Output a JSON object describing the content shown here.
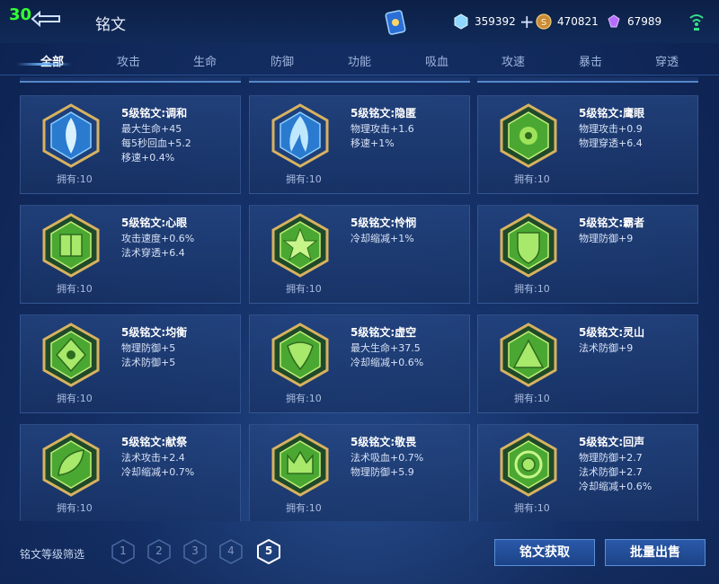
{
  "fps": "30",
  "title": "铭文",
  "currencies": [
    {
      "icon": "diamond-icon",
      "value": "359392",
      "color": "#8fd7ff"
    },
    {
      "icon": "gold-coin-icon",
      "value": "470821",
      "color": "#d8a24a"
    },
    {
      "icon": "crystal-icon",
      "value": "67989",
      "color": "#b66dff"
    }
  ],
  "tabs": [
    "全部",
    "攻击",
    "生命",
    "防御",
    "功能",
    "吸血",
    "攻速",
    "暴击",
    "穿透"
  ],
  "runes": [
    {
      "name": "5级铭文:调和",
      "stats": [
        "最大生命+45",
        "每5秒回血+5.2",
        "移速+0.4%"
      ],
      "owned": "拥有:10",
      "icon": "blue-water-drop-icon"
    },
    {
      "name": "5级铭文:隐匿",
      "stats": [
        "物理攻击+1.6",
        "移速+1%"
      ],
      "owned": "拥有:10",
      "icon": "blue-flame-icon"
    },
    {
      "name": "5级铭文:鹰眼",
      "stats": [
        "物理攻击+0.9",
        "物理穿透+6.4"
      ],
      "owned": "拥有:10",
      "icon": "green-eye-icon"
    },
    {
      "name": "5级铭文:心眼",
      "stats": [
        "攻击速度+0.6%",
        "法术穿透+6.4"
      ],
      "owned": "拥有:10",
      "icon": "green-book-icon"
    },
    {
      "name": "5级铭文:怜悯",
      "stats": [
        "冷却缩减+1%"
      ],
      "owned": "拥有:10",
      "icon": "green-star-icon"
    },
    {
      "name": "5级铭文:霸者",
      "stats": [
        "物理防御+9"
      ],
      "owned": "拥有:10",
      "icon": "green-shield-icon"
    },
    {
      "name": "5级铭文:均衡",
      "stats": [
        "物理防御+5",
        "法术防御+5"
      ],
      "owned": "拥有:10",
      "icon": "green-balance-icon"
    },
    {
      "name": "5级铭文:虚空",
      "stats": [
        "最大生命+37.5",
        "冷却缩减+0.6%"
      ],
      "owned": "拥有:10",
      "icon": "green-void-icon"
    },
    {
      "name": "5级铭文:灵山",
      "stats": [
        "法术防御+9"
      ],
      "owned": "拥有:10",
      "icon": "green-mountain-icon"
    },
    {
      "name": "5级铭文:献祭",
      "stats": [
        "法术攻击+2.4",
        "冷却缩减+0.7%"
      ],
      "owned": "拥有:10",
      "icon": "green-leaf-icon"
    },
    {
      "name": "5级铭文:敬畏",
      "stats": [
        "法术吸血+0.7%",
        "物理防御+5.9"
      ],
      "owned": "拥有:10",
      "icon": "green-crown-icon"
    },
    {
      "name": "5级铭文:回声",
      "stats": [
        "物理防御+2.7",
        "法术防御+2.7",
        "冷却缩减+0.6%"
      ],
      "owned": "拥有:10",
      "icon": "green-echo-icon"
    }
  ],
  "filter": {
    "label": "铭文等级筛选",
    "levels": [
      "1",
      "2",
      "3",
      "4",
      "5"
    ],
    "selected": "5"
  },
  "buttons": {
    "acquire": "铭文获取",
    "sell": "批量出售"
  }
}
